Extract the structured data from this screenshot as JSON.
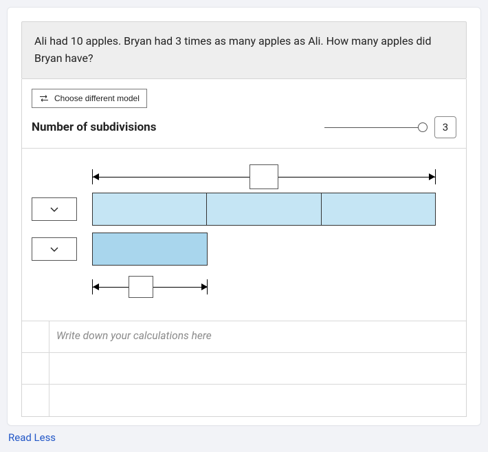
{
  "question": "Ali had 10 apples. Bryan had 3 times as many apples as Ali. How many apples did Bryan have?",
  "toolbar": {
    "choose_model_label": "Choose different model"
  },
  "subdivisions": {
    "label": "Number of subdivisions",
    "value": "3"
  },
  "calculations": {
    "placeholder": "Write down your calculations here"
  },
  "footer": {
    "read_less": "Read Less"
  }
}
